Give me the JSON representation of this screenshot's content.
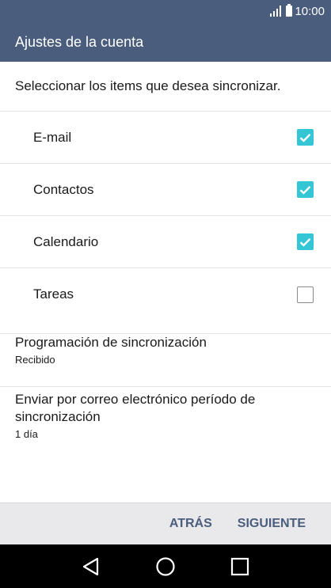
{
  "status_bar": {
    "time": "10:00"
  },
  "action_bar": {
    "title": "Ajustes de la cuenta"
  },
  "instruction": "Seleccionar los items que desea sincronizar.",
  "sync_items": [
    {
      "label": "E-mail",
      "checked": true
    },
    {
      "label": "Contactos",
      "checked": true
    },
    {
      "label": "Calendario",
      "checked": true
    },
    {
      "label": "Tareas",
      "checked": false
    }
  ],
  "schedule": {
    "title": "Programación de sincronización",
    "value": "Recibido"
  },
  "period": {
    "title": "Enviar por correo electrónico período de sincronización",
    "value": "1 día"
  },
  "footer": {
    "back_label": "ATRÁS",
    "next_label": "SIGUIENTE"
  },
  "nav_icons": [
    "back-triangle-icon",
    "home-circle-icon",
    "recents-square-icon"
  ],
  "colors": {
    "accent": "#35c6d6",
    "bar": "#4a5d7c",
    "footer_bg": "#e9e9ec",
    "footer_text": "#4a5d7c"
  }
}
